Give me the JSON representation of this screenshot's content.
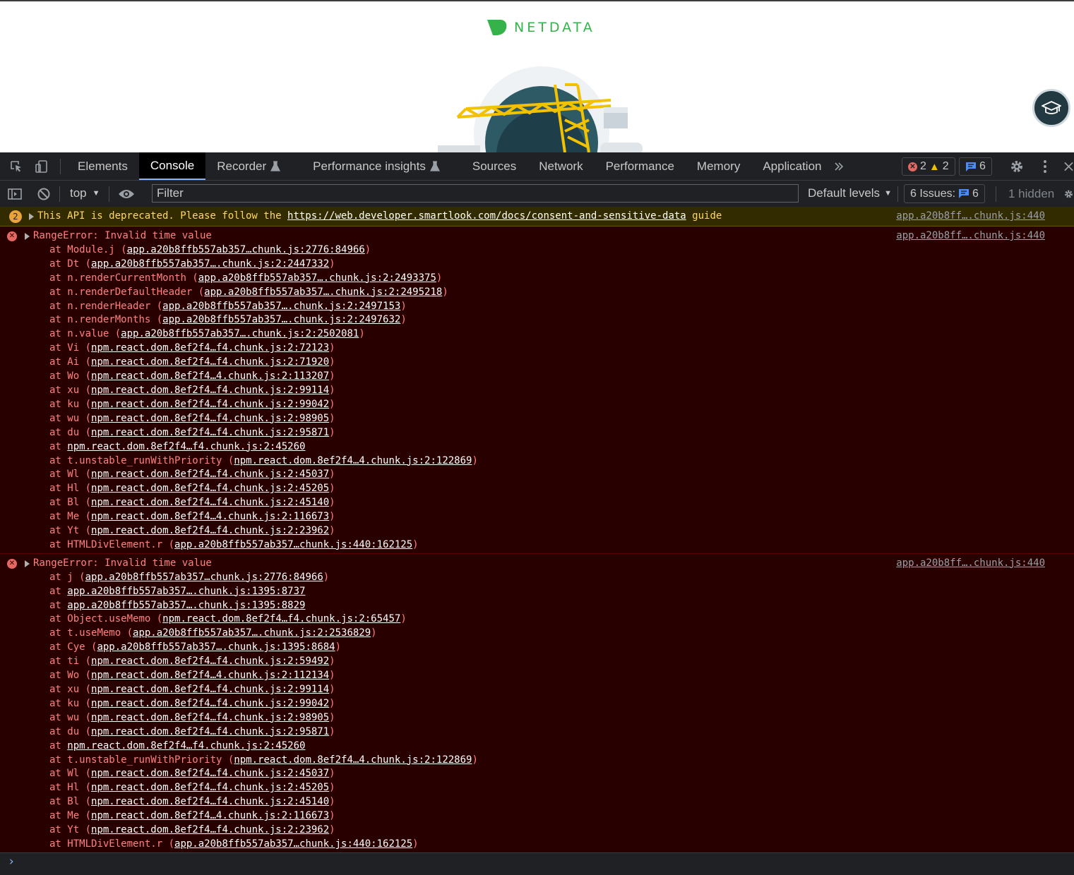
{
  "page": {
    "logo_text": "NETDATA"
  },
  "tabs": [
    {
      "label": "Elements",
      "beta": false
    },
    {
      "label": "Console",
      "beta": false
    },
    {
      "label": "Recorder",
      "beta": true
    },
    {
      "label": "Performance insights",
      "beta": true
    },
    {
      "label": "Sources",
      "beta": false
    },
    {
      "label": "Network",
      "beta": false
    },
    {
      "label": "Performance",
      "beta": false
    },
    {
      "label": "Memory",
      "beta": false
    },
    {
      "label": "Application",
      "beta": false
    }
  ],
  "badges": {
    "errors": "2",
    "warnings": "2",
    "messages": "6"
  },
  "filterbar": {
    "context": "top",
    "filter_placeholder": "Filter",
    "levels": "Default levels",
    "issues_label": "6 Issues:",
    "issues_count": "6",
    "hidden": "1 hidden"
  },
  "warning": {
    "count": "2",
    "text_before": "This API is deprecated. Please follow the ",
    "link": "https://web.developer.smartlook.com/docs/consent-and-sensitive-data",
    "text_after": " guide",
    "source": "app.a20b8ff….chunk.js:440"
  },
  "errors": [
    {
      "title": "RangeError: Invalid time value",
      "source": "app.a20b8ff….chunk.js:440",
      "frames": [
        {
          "fn": "Module.j",
          "loc": "app.a20b8ffb557ab357…chunk.js:2776:84966"
        },
        {
          "fn": "Dt",
          "loc": "app.a20b8ffb557ab357….chunk.js:2:2447332"
        },
        {
          "fn": "n.renderCurrentMonth",
          "loc": "app.a20b8ffb557ab357….chunk.js:2:2493375"
        },
        {
          "fn": "n.renderDefaultHeader",
          "loc": "app.a20b8ffb557ab357….chunk.js:2:2495218"
        },
        {
          "fn": "n.renderHeader",
          "loc": "app.a20b8ffb557ab357….chunk.js:2:2497153"
        },
        {
          "fn": "n.renderMonths",
          "loc": "app.a20b8ffb557ab357….chunk.js:2:2497632"
        },
        {
          "fn": "n.value",
          "loc": "app.a20b8ffb557ab357….chunk.js:2:2502081"
        },
        {
          "fn": "Vi",
          "loc": "npm.react.dom.8ef2f4…f4.chunk.js:2:72123"
        },
        {
          "fn": "Ai",
          "loc": "npm.react.dom.8ef2f4…f4.chunk.js:2:71920"
        },
        {
          "fn": "Wo",
          "loc": "npm.react.dom.8ef2f4…4.chunk.js:2:113207"
        },
        {
          "fn": "xu",
          "loc": "npm.react.dom.8ef2f4…f4.chunk.js:2:99114"
        },
        {
          "fn": "ku",
          "loc": "npm.react.dom.8ef2f4…f4.chunk.js:2:99042"
        },
        {
          "fn": "wu",
          "loc": "npm.react.dom.8ef2f4…f4.chunk.js:2:98905"
        },
        {
          "fn": "du",
          "loc": "npm.react.dom.8ef2f4…f4.chunk.js:2:95871"
        },
        {
          "fn": "",
          "loc": "npm.react.dom.8ef2f4…f4.chunk.js:2:45260"
        },
        {
          "fn": "t.unstable_runWithPriority",
          "loc": "npm.react.dom.8ef2f4…4.chunk.js:2:122869"
        },
        {
          "fn": "Wl",
          "loc": "npm.react.dom.8ef2f4…f4.chunk.js:2:45037"
        },
        {
          "fn": "Hl",
          "loc": "npm.react.dom.8ef2f4…f4.chunk.js:2:45205"
        },
        {
          "fn": "Bl",
          "loc": "npm.react.dom.8ef2f4…f4.chunk.js:2:45140"
        },
        {
          "fn": "Me",
          "loc": "npm.react.dom.8ef2f4…4.chunk.js:2:116673"
        },
        {
          "fn": "Yt",
          "loc": "npm.react.dom.8ef2f4…f4.chunk.js:2:23962"
        },
        {
          "fn": "HTMLDivElement.r",
          "loc": "app.a20b8ffb557ab357…chunk.js:440:162125"
        }
      ]
    },
    {
      "title": "RangeError: Invalid time value",
      "source": "app.a20b8ff….chunk.js:440",
      "frames": [
        {
          "fn": "j",
          "loc": "app.a20b8ffb557ab357…chunk.js:2776:84966"
        },
        {
          "fn": "",
          "loc": "app.a20b8ffb557ab357….chunk.js:1395:8737"
        },
        {
          "fn": "",
          "loc": "app.a20b8ffb557ab357….chunk.js:1395:8829"
        },
        {
          "fn": "Object.useMemo",
          "loc": "npm.react.dom.8ef2f4…f4.chunk.js:2:65457"
        },
        {
          "fn": "t.useMemo",
          "loc": "app.a20b8ffb557ab357….chunk.js:2:2536829"
        },
        {
          "fn": "Cye",
          "loc": "app.a20b8ffb557ab357….chunk.js:1395:8684"
        },
        {
          "fn": "ti",
          "loc": "npm.react.dom.8ef2f4…f4.chunk.js:2:59492"
        },
        {
          "fn": "Wo",
          "loc": "npm.react.dom.8ef2f4…4.chunk.js:2:112134"
        },
        {
          "fn": "xu",
          "loc": "npm.react.dom.8ef2f4…f4.chunk.js:2:99114"
        },
        {
          "fn": "ku",
          "loc": "npm.react.dom.8ef2f4…f4.chunk.js:2:99042"
        },
        {
          "fn": "wu",
          "loc": "npm.react.dom.8ef2f4…f4.chunk.js:2:98905"
        },
        {
          "fn": "du",
          "loc": "npm.react.dom.8ef2f4…f4.chunk.js:2:95871"
        },
        {
          "fn": "",
          "loc": "npm.react.dom.8ef2f4…f4.chunk.js:2:45260"
        },
        {
          "fn": "t.unstable_runWithPriority",
          "loc": "npm.react.dom.8ef2f4…4.chunk.js:2:122869"
        },
        {
          "fn": "Wl",
          "loc": "npm.react.dom.8ef2f4…f4.chunk.js:2:45037"
        },
        {
          "fn": "Hl",
          "loc": "npm.react.dom.8ef2f4…f4.chunk.js:2:45205"
        },
        {
          "fn": "Bl",
          "loc": "npm.react.dom.8ef2f4…f4.chunk.js:2:45140"
        },
        {
          "fn": "Me",
          "loc": "npm.react.dom.8ef2f4…4.chunk.js:2:116673"
        },
        {
          "fn": "Yt",
          "loc": "npm.react.dom.8ef2f4…f4.chunk.js:2:23962"
        },
        {
          "fn": "HTMLDivElement.r",
          "loc": "app.a20b8ffb557ab357…chunk.js:440:162125"
        }
      ]
    }
  ],
  "icons": [
    "select-element-icon",
    "device-toolbar-icon",
    "flask-icon",
    "more-tabs-icon",
    "settings-gear-icon",
    "kebab-menu-icon",
    "close-icon",
    "sidebar-toggle-icon",
    "clear-console-icon",
    "eye-icon",
    "gear-icon",
    "graduation-cap-icon"
  ],
  "colors": {
    "accent": "#8ab4f8",
    "error_bg": "#290000",
    "error_text": "#ff8080",
    "warning_bg": "#332b00",
    "warning_text": "#ffd764",
    "netdata_green": "#35b34a"
  }
}
